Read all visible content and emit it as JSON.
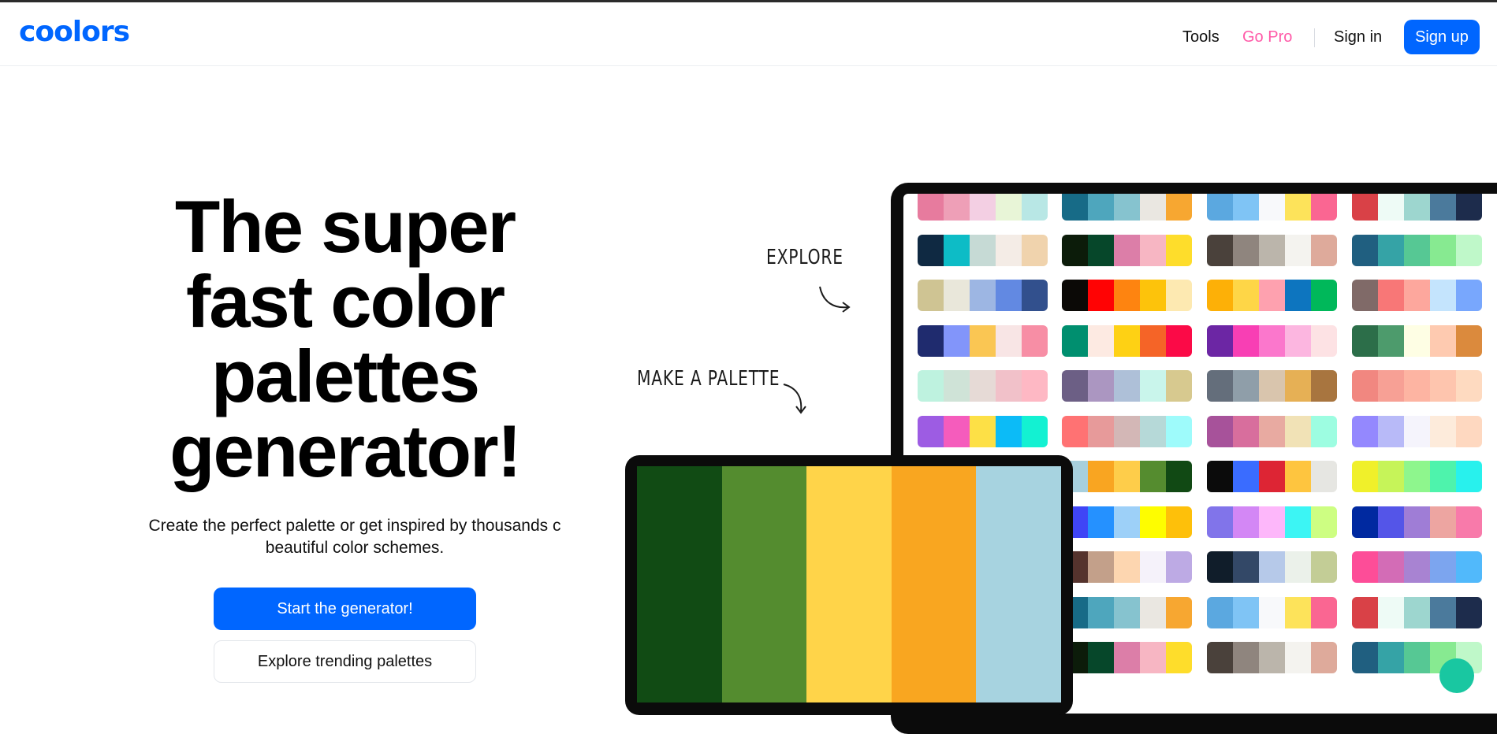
{
  "header": {
    "logo_text": "coolors",
    "nav": {
      "tools": "Tools",
      "go_pro": "Go Pro",
      "sign_in": "Sign in",
      "sign_up": "Sign up"
    }
  },
  "hero": {
    "title_lines": [
      "The super",
      "fast color",
      "palettes",
      "generator!"
    ],
    "subtitle_line1": "Create the perfect palette or get inspired by thousands c",
    "subtitle_line2": "beautiful color schemes.",
    "primary_cta": "Start the generator!",
    "secondary_cta": "Explore trending palettes"
  },
  "annotations": {
    "explore": "EXPLORE",
    "make_palette": "MAKE A PALETTE"
  },
  "colors": {
    "brand": "#0066ff",
    "pro": "#ff5aa8",
    "chat": "#19c7a1"
  },
  "featured_palette": [
    "#114b14",
    "#548c2f",
    "#ffd449",
    "#f9a620",
    "#a7d3e0"
  ],
  "palette_grid": [
    [
      [
        "#e77b9e",
        "#ee9fb7",
        "#f3cfe3",
        "#e8f5d7",
        "#b8e7e5"
      ],
      [
        "#176b87",
        "#4ea6bd",
        "#86c3cf",
        "#eae7e1",
        "#f7a731"
      ],
      [
        "#5ba8e0",
        "#7fc4f5",
        "#f8f9fb",
        "#fde35a",
        "#fa6692"
      ],
      [
        "#d94147",
        "#eefbf6",
        "#9dd6cf",
        "#4b7a9c",
        "#1d2c4c"
      ]
    ],
    [
      [
        "#0f2942",
        "#0dbcc6",
        "#c6dad5",
        "#f4ece6",
        "#f0d3ad"
      ],
      [
        "#0c1c0a",
        "#06472a",
        "#dc7ea8",
        "#f7b6c3",
        "#fedd2b"
      ],
      [
        "#4a413b",
        "#8f857e",
        "#bbb5ab",
        "#f4f3ef",
        "#deaa9b"
      ],
      [
        "#205f80",
        "#35a3a6",
        "#56c894",
        "#87ea91",
        "#bff8c9"
      ]
    ],
    [
      [
        "#cfc493",
        "#e9e7da",
        "#9db6e3",
        "#6289e2",
        "#32508d"
      ],
      [
        "#0b0906",
        "#ff0304",
        "#fe8410",
        "#fdc30b",
        "#fde9b1"
      ],
      [
        "#fdb007",
        "#fed647",
        "#fea1af",
        "#0d75bf",
        "#00b85a"
      ],
      [
        "#806a68",
        "#f87777",
        "#fda79d",
        "#c4e4fd",
        "#78a7fd"
      ]
    ],
    [
      [
        "#1f2b6e",
        "#8295fa",
        "#fac653",
        "#f8e5e5",
        "#f78ea5"
      ],
      [
        "#008f6f",
        "#fdeae2",
        "#fed114",
        "#f56427",
        "#fb0a47"
      ],
      [
        "#6c26a4",
        "#f83fb4",
        "#fb77cc",
        "#fcb6e0",
        "#fde2e4"
      ],
      [
        "#2c6e49",
        "#4d9b6c",
        "#fefee4",
        "#fecab0",
        "#db8a3d"
      ]
    ],
    [
      [
        "#bef2df",
        "#cfe3d7",
        "#e6dad6",
        "#f1c1c9",
        "#feb8c4"
      ],
      [
        "#6c5f85",
        "#ab96c1",
        "#aec0d8",
        "#c9f5eb",
        "#d7c98f"
      ],
      [
        "#646e7b",
        "#8f9ea9",
        "#d9c5ad",
        "#e6b055",
        "#a8753f"
      ],
      [
        "#f18780",
        "#f7a095",
        "#fdb4a2",
        "#fec5ae",
        "#fedac0"
      ]
    ],
    [
      [
        "#9d5ce3",
        "#f55cbc",
        "#fde046",
        "#0cbbf7",
        "#13f1d2"
      ],
      [
        "#ff7273",
        "#e79a9a",
        "#d3b7b6",
        "#b6d9d8",
        "#9efbfb"
      ],
      [
        "#a7529a",
        "#d86e9d",
        "#e8aaa1",
        "#f1e2b6",
        "#9dfde1"
      ],
      [
        "#9488fe",
        "#b8baf8",
        "#f5f4fc",
        "#fdebdb",
        "#fed8c0"
      ]
    ],
    [
      [
        "#e27ae7",
        "#ef9fe3",
        "#f3c9ee",
        "#c3e8f0",
        "#aae7e3"
      ],
      [
        "#a7cfdd",
        "#f9a521",
        "#fecd4a",
        "#558c2f",
        "#114914"
      ],
      [
        "#0b0b0b",
        "#3a6cff",
        "#dd2534",
        "#fec53f",
        "#e6e6e2"
      ],
      [
        "#f0f02a",
        "#c6f459",
        "#8ef68d",
        "#4ef3ac",
        "#28f1ed"
      ]
    ],
    [
      [
        "#0e0c80",
        "#1f0cfa",
        "#2a98fb",
        "#a3d3f6",
        "#fef401"
      ],
      [
        "#3f45f6",
        "#2591ff",
        "#9dd0f8",
        "#fefd00",
        "#fec00a"
      ],
      [
        "#8174ea",
        "#d387f5",
        "#fdb7fa",
        "#3cf5f4",
        "#cdfe82"
      ],
      [
        "#0029a0",
        "#5455e8",
        "#9f7dd6",
        "#eda5a1",
        "#f87aaa"
      ]
    ],
    [
      [
        "#55332d",
        "#c3a08a",
        "#fdd6b0",
        "#f5f2fa",
        "#bdaae4"
      ],
      [
        "#55332d",
        "#c3a08a",
        "#fdd6b0",
        "#f5f2fa",
        "#bdaae4"
      ],
      [
        "#101d2a",
        "#334867",
        "#b6c9e9",
        "#ebf1ea",
        "#c3cd96"
      ],
      [
        "#fd4d98",
        "#d36cb6",
        "#a883d2",
        "#7ca5ef",
        "#51b9fb"
      ]
    ],
    [
      [
        "#176b87",
        "#4ea6bd",
        "#86c3cf",
        "#eae7e1",
        "#f7a731"
      ],
      [
        "#176b87",
        "#4ea6bd",
        "#86c3cf",
        "#eae7e1",
        "#f7a731"
      ],
      [
        "#5ba8e0",
        "#7fc4f5",
        "#f8f9fb",
        "#fde35a",
        "#fa6692"
      ],
      [
        "#d94147",
        "#eefbf6",
        "#9dd6cf",
        "#4b7a9c",
        "#1d2c4c"
      ]
    ],
    [
      [
        "#0c1c0a",
        "#06472a",
        "#dc7ea8",
        "#f7b6c3",
        "#fedd2b"
      ],
      [
        "#0c1c0a",
        "#06472a",
        "#dc7ea8",
        "#f7b6c3",
        "#fedd2b"
      ],
      [
        "#4a413b",
        "#8f857e",
        "#bbb5ab",
        "#f4f3ef",
        "#deaa9b"
      ],
      [
        "#205f80",
        "#35a3a6",
        "#56c894",
        "#87ea91",
        "#bff8c9"
      ]
    ]
  ]
}
